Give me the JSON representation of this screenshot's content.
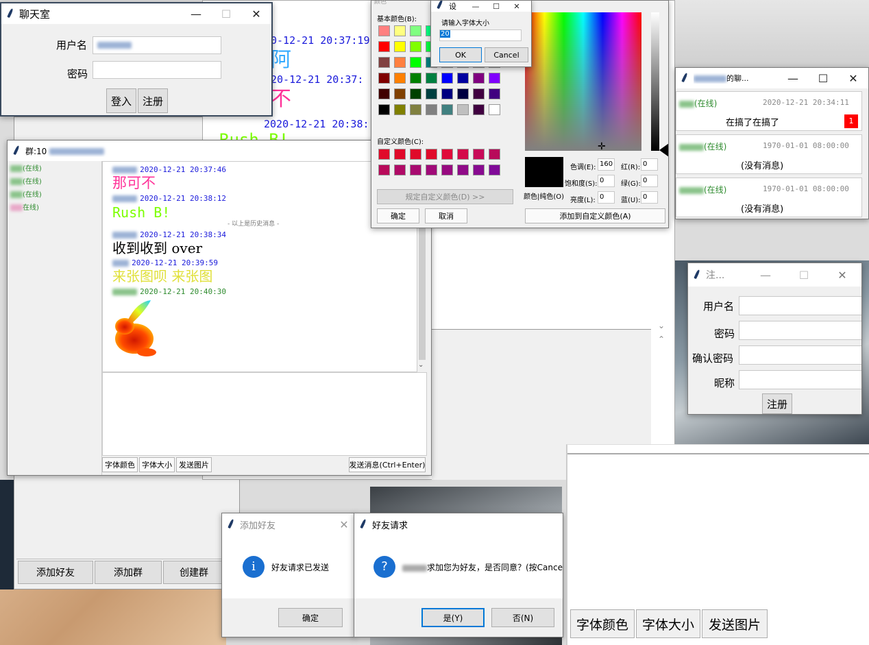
{
  "colors": {
    "online_green": "#2e8b2e",
    "timestamp_blue": "#1a1adb",
    "pink": "#ff3399",
    "lime": "#7cff00",
    "yellow": "#e0e03a",
    "unread_red": "#ff0000"
  },
  "login": {
    "title": "聊天室",
    "username_label": "用户名",
    "password_label": "密码",
    "login_button": "登入",
    "register_button": "注册"
  },
  "bg_chat": {
    "lines": [
      "0-12-21 20:37:19",
      "阿",
      "20-12-21 20:37:",
      "不",
      "2020-12-21 20:38:",
      "Rush B!"
    ]
  },
  "group": {
    "title": "群:10",
    "members": [
      "(在线)",
      "(在线)",
      "(在线)",
      "在线)"
    ],
    "messages": [
      {
        "time": "2020-12-21 20:37:46",
        "text": "那可不",
        "color": "#ff3399"
      },
      {
        "time": "2020-12-21 20:38:12",
        "text": "Rush B!",
        "color": "#7cff00"
      },
      {
        "time": "2020-12-21 20:38:34",
        "text": "收到收到 over",
        "color": "#000000"
      },
      {
        "time": "2020-12-21 20:39:59",
        "text": "来张图呗 来张图",
        "color": "#e0e03a"
      },
      {
        "time": "2020-12-21 20:40:30",
        "text": "",
        "color": "#000000"
      }
    ],
    "history_divider": "- 以上是历史消息 -",
    "font_color_button": "字体颜色",
    "font_size_button": "字体大小",
    "send_image_button": "发送图片",
    "send_button": "发送消息(Ctrl+Enter)"
  },
  "color_dialog": {
    "title": "颜色",
    "basic_colors_label": "基本颜色(B):",
    "custom_colors_label": "自定义颜色(C):",
    "define_custom_button": "规定自定义颜色(D) >>",
    "ok_button": "确定",
    "cancel_button": "取消",
    "color_solid_label": "颜色|纯色(O)",
    "hue_label": "色调(E):",
    "hue_value": "160",
    "sat_label": "饱和度(S):",
    "sat_value": "0",
    "lum_label": "亮度(L):",
    "lum_value": "0",
    "red_label": "红(R):",
    "red_value": "0",
    "green_label": "绿(G):",
    "green_value": "0",
    "blue_label": "蓝(U):",
    "blue_value": "0",
    "add_custom_button": "添加到自定义颜色(A)",
    "basic": [
      [
        "#ff8080",
        "#ffff80",
        "#80ff80",
        "#00ff80",
        "#80ffff",
        "#0080ff",
        "#ff80c0",
        "#ff80ff"
      ],
      [
        "#ff0000",
        "#ffff00",
        "#80ff00",
        "#00ff40",
        "#00ffff",
        "#0080c0",
        "#8080c0",
        "#ff00ff"
      ],
      [
        "#804040",
        "#ff8040",
        "#00ff00",
        "#008080",
        "#004080",
        "#8080ff",
        "#800040",
        "#ff0080"
      ],
      [
        "#800000",
        "#ff8000",
        "#008000",
        "#008040",
        "#0000ff",
        "#0000a0",
        "#800080",
        "#8000ff"
      ],
      [
        "#400000",
        "#804000",
        "#004000",
        "#004040",
        "#000080",
        "#000040",
        "#400040",
        "#400080"
      ],
      [
        "#000000",
        "#808000",
        "#808040",
        "#808080",
        "#408080",
        "#c0c0c0",
        "#400040",
        "#ffffff"
      ]
    ],
    "custom": [
      [
        "#e00a2a",
        "#e00a2a",
        "#e00a2a",
        "#e00a2a",
        "#e00a3a",
        "#d40a4a",
        "#c80a58",
        "#b80a5a"
      ],
      [
        "#b80a5a",
        "#b00a66",
        "#a80a70",
        "#a00a78",
        "#980a80",
        "#900a88",
        "#880a90",
        "#800a98"
      ]
    ]
  },
  "size_dialog": {
    "title": "设",
    "prompt": "请输入字体大小",
    "value": "20",
    "ok_button": "OK",
    "cancel_button": "Cancel"
  },
  "friends": {
    "title": "的聊...",
    "items": [
      {
        "status": "(在线)",
        "time": "2020-12-21 20:34:11",
        "preview": "在搞了在搞了",
        "unread": "1"
      },
      {
        "status": "(在线)",
        "time": "1970-01-01 08:00:00",
        "preview": "(没有消息)"
      },
      {
        "status": "(在线)",
        "time": "1970-01-01 08:00:00",
        "preview": "(没有消息)"
      }
    ]
  },
  "register": {
    "title": "注...",
    "username_label": "用户名",
    "password_label": "密码",
    "confirm_label": "确认密码",
    "nickname_label": "昵称",
    "register_button": "注册"
  },
  "bottom_bar": {
    "add_friend": "添加好友",
    "add_group": "添加群",
    "create_group": "创建群"
  },
  "add_friend_dialog": {
    "title": "添加好友",
    "message": "好友请求已发送",
    "ok_button": "确定"
  },
  "friend_request_dialog": {
    "title": "好友请求",
    "message": "求加您为好友，是否同意？(按Cancel",
    "yes_button": "是(Y)",
    "no_button": "否(N)"
  },
  "zoom_toolbar": {
    "font_color": "字体颜色",
    "font_size": "字体大小",
    "send_image": "发送图片"
  }
}
